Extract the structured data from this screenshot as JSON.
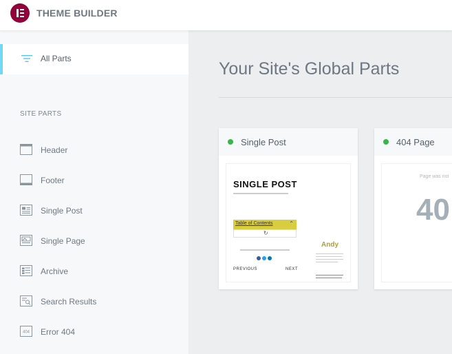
{
  "header": {
    "title": "THEME BUILDER",
    "logo": "elementor-logo"
  },
  "sidebar": {
    "all_parts_label": "All Parts",
    "section_title": "SITE PARTS",
    "items": [
      {
        "label": "Header",
        "icon": "header-icon"
      },
      {
        "label": "Footer",
        "icon": "footer-icon"
      },
      {
        "label": "Single Post",
        "icon": "single-post-icon"
      },
      {
        "label": "Single Page",
        "icon": "single-page-icon"
      },
      {
        "label": "Archive",
        "icon": "archive-icon"
      },
      {
        "label": "Search Results",
        "icon": "search-results-icon"
      },
      {
        "label": "Error 404",
        "icon": "error-404-icon",
        "badge": "404"
      }
    ]
  },
  "main": {
    "title": "Your Site's Global Parts",
    "cards": [
      {
        "title": "Single Post",
        "status_color": "#39b54a",
        "preview": {
          "heading": "SINGLE POST",
          "toc_label": "Table of Contents",
          "author": "Andy",
          "prev": "PREVIOUS",
          "next": "NEXT"
        }
      },
      {
        "title": "404 Page",
        "status_color": "#39b54a",
        "preview": {
          "message": "Page was not",
          "code": "40"
        }
      }
    ]
  },
  "colors": {
    "brand": "#92003b",
    "accent": "#71d7f7",
    "active_dot": "#39b54a"
  }
}
